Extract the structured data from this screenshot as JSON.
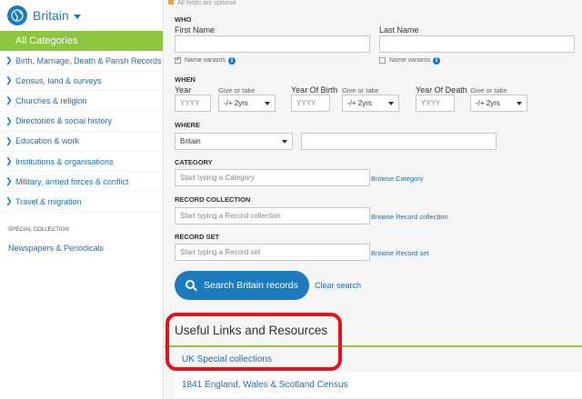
{
  "sidebar": {
    "region": "Britain",
    "all_categories": "All Categories",
    "categories": [
      "Birth, Marriage, Death & Parish Records",
      "Census, land & surveys",
      "Churches & religion",
      "Directories & social history",
      "Education & work",
      "Institutions & organisations",
      "Military, armed forces & conflict",
      "Travel & migration"
    ],
    "special_heading": "SPECIAL COLLECTION",
    "special_item": "Newspapers & Periodicals"
  },
  "form": {
    "note": "All fields are optional",
    "who": {
      "heading": "WHO",
      "first_name_label": "First Name",
      "last_name_label": "Last Name",
      "name_variants": "Name variants",
      "first_variants_checked": true,
      "last_variants_checked": false
    },
    "when": {
      "heading": "WHEN",
      "year_label": "Year",
      "birth_label": "Year Of Birth",
      "death_label": "Year Of Death",
      "give_or_take": "Give or take",
      "year_placeholder": "YYYY",
      "range_value": "-/+ 2yrs"
    },
    "where": {
      "heading": "WHERE",
      "country_value": "Britain"
    },
    "category": {
      "heading": "CATEGORY",
      "placeholder": "Start typing a Category",
      "browse": "Browse Category"
    },
    "record_collection": {
      "heading": "RECORD COLLECTION",
      "placeholder": "Start typing a Record collection",
      "browse": "Browse Record collection"
    },
    "record_set": {
      "heading": "RECORD SET",
      "placeholder": "Start typing a Record set",
      "browse": "Browse Record set"
    },
    "search_button": "Search Britain records",
    "clear": "Clear search"
  },
  "resources": {
    "title": "Useful Links and Resources",
    "items": [
      "UK Special collections",
      "1841 England, Wales & Scotland Census"
    ]
  },
  "colors": {
    "brand_blue": "#1c7bbf",
    "accent_green": "#8cc63f",
    "highlight_red": "#e2141b"
  }
}
